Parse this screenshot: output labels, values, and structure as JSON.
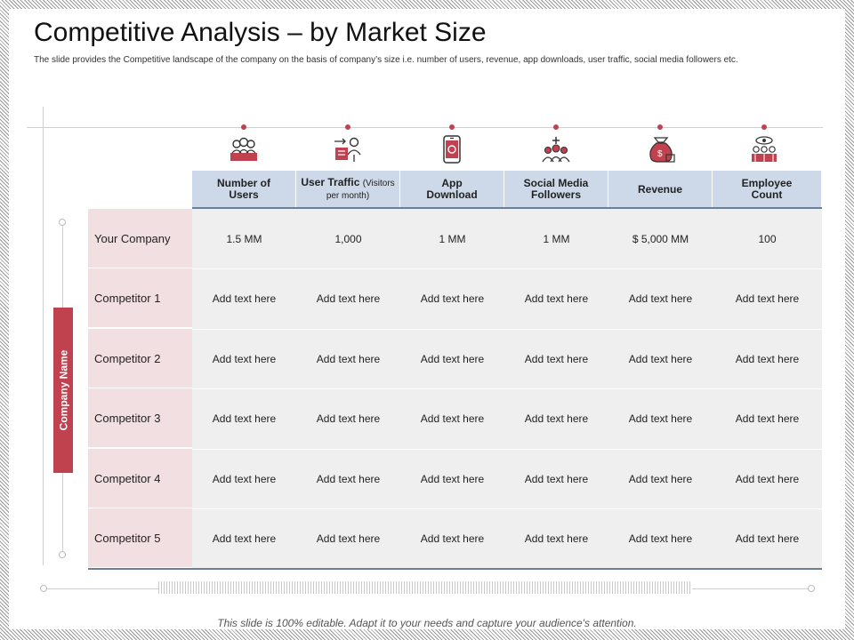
{
  "slide": {
    "title": "Competitive Analysis – by Market Size",
    "subtitle": "The slide provides the Competitive landscape of the company on the basis of company’s size i.e. number of users, revenue, app downloads, user traffic, social media followers etc.",
    "footer": "This slide is 100% editable. Adapt it to your needs and capture your audience's attention.",
    "side_label": "Company Name"
  },
  "icons": [
    "users-group-icon",
    "user-traffic-icon",
    "mobile-app-icon",
    "social-network-icon",
    "money-bag-icon",
    "team-icon"
  ],
  "colors": {
    "accent": "#c0424e",
    "header": "#cdd8e8",
    "name_cell": "#f2dfe2",
    "grid": "#efefef",
    "line": "#6b7f99"
  },
  "columns": [
    {
      "label": "Number of Users",
      "sub": ""
    },
    {
      "label": "User Traffic",
      "sub": "(Visitors per month)"
    },
    {
      "label": "App Download",
      "sub": ""
    },
    {
      "label": "Social Media Followers",
      "sub": ""
    },
    {
      "label": "Revenue",
      "sub": ""
    },
    {
      "label": "Employee Count",
      "sub": ""
    }
  ],
  "rows": [
    {
      "name": "Your Company",
      "cells": [
        "1.5 MM",
        "1,000",
        "1 MM",
        "1 MM",
        "$ 5,000 MM",
        "100"
      ]
    },
    {
      "name": "Competitor 1",
      "cells": [
        "Add text here",
        "Add text here",
        "Add text here",
        "Add text here",
        "Add text here",
        "Add text here"
      ]
    },
    {
      "name": "Competitor 2",
      "cells": [
        "Add text here",
        "Add text here",
        "Add text here",
        "Add text here",
        "Add text here",
        "Add text here"
      ]
    },
    {
      "name": "Competitor 3",
      "cells": [
        "Add text here",
        "Add text here",
        "Add text here",
        "Add text here",
        "Add text here",
        "Add text here"
      ]
    },
    {
      "name": "Competitor 4",
      "cells": [
        "Add text here",
        "Add text here",
        "Add text here",
        "Add text here",
        "Add text here",
        "Add text here"
      ]
    },
    {
      "name": "Competitor 5",
      "cells": [
        "Add text here",
        "Add text here",
        "Add text here",
        "Add text here",
        "Add text here",
        "Add text here"
      ]
    }
  ]
}
